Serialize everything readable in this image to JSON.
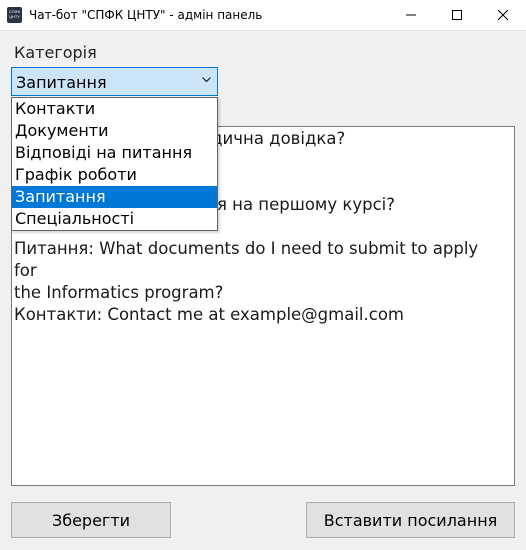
{
  "window": {
    "title": "Чат-бот \"СПФК ЦНТУ\" - адмін панель",
    "icon_text": "СПФК ЦНТУ"
  },
  "category": {
    "label": "Категорія",
    "selected": "Запитання",
    "options": [
      "Контакти",
      "Документи",
      "Відповіді на питання",
      "Графік роботи",
      "Запитання",
      "Спеціальності"
    ],
    "selected_index": 4
  },
  "editor": {
    "visible_lines": [
      "едична довідка?",
      "",
      "",
      "дія на першому курсі?",
      "",
      "Питання: What documents do I need to submit to apply for",
      "the Informatics program?",
      "Контакти: Contact me at example@gmail.com"
    ]
  },
  "buttons": {
    "save": "Зберегти",
    "insert_link": "Вставити посилання"
  },
  "colors": {
    "accent": "#0078d7",
    "combo_bg": "#cce4f7",
    "window_bg": "#f0f0f0"
  }
}
